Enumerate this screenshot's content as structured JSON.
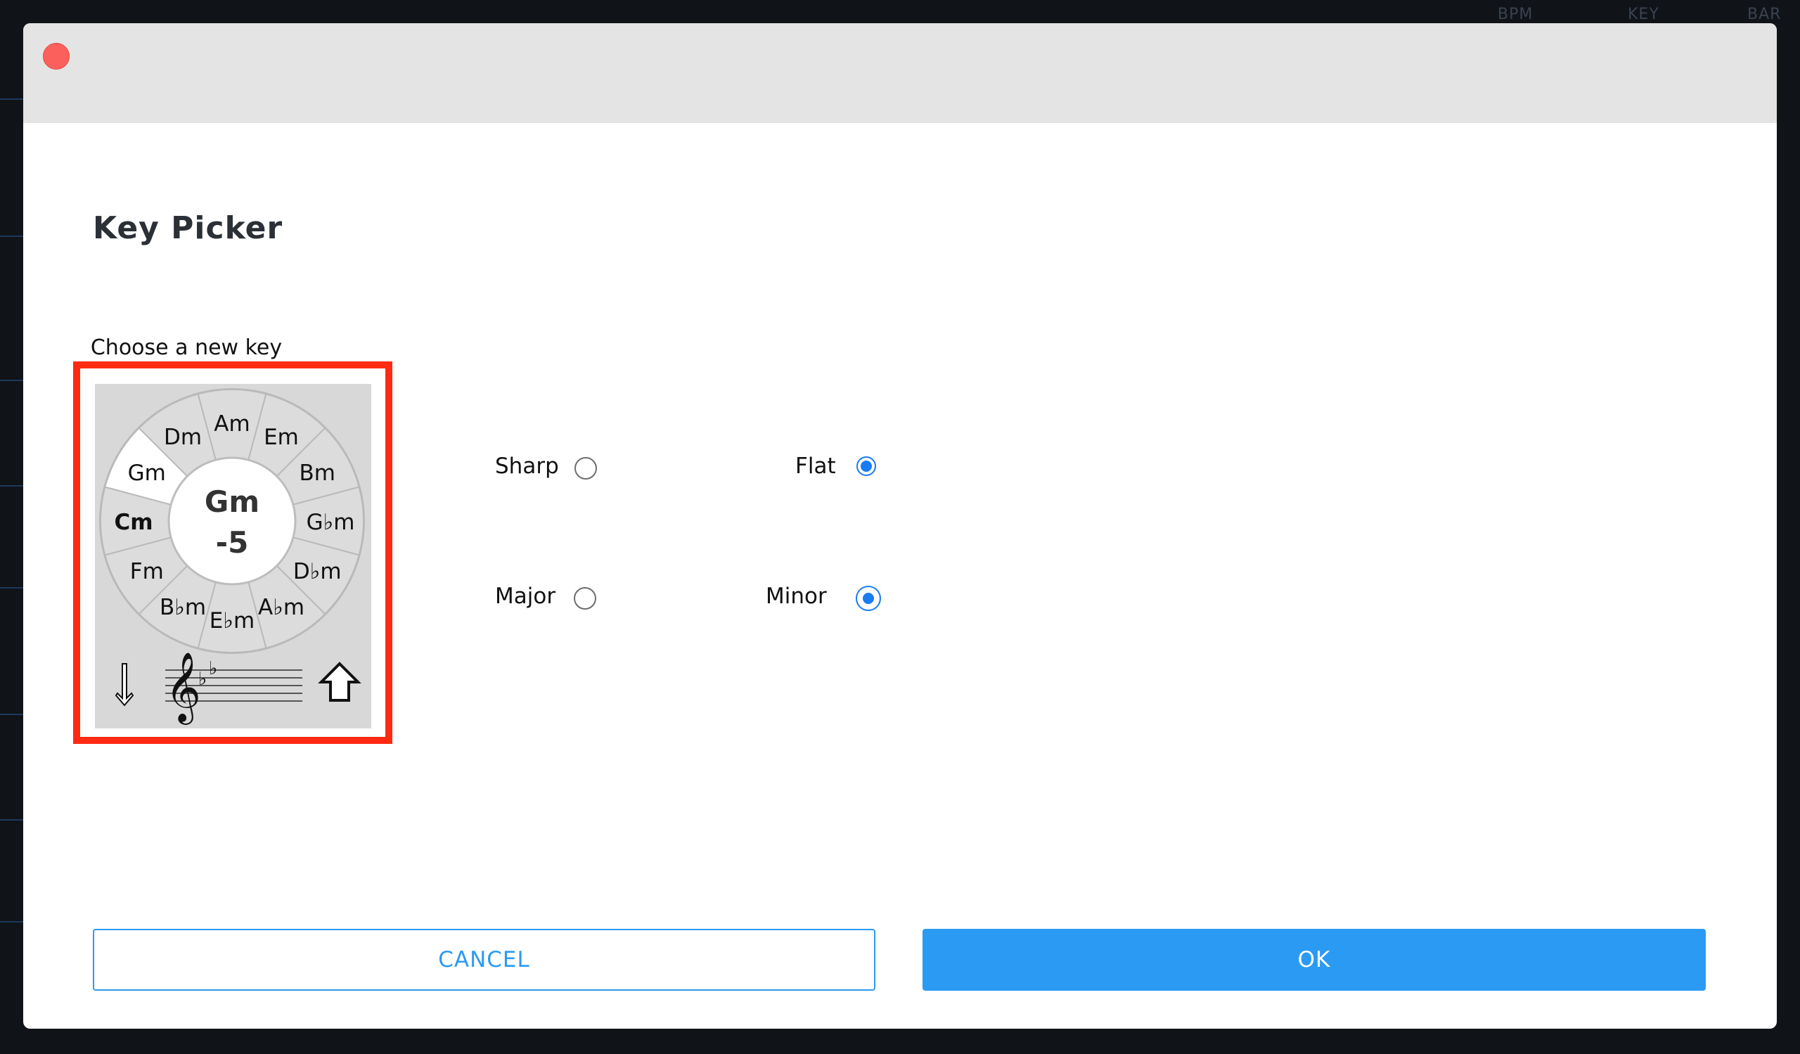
{
  "background": {
    "column_headers": [
      "BPM",
      "KEY",
      "BAR"
    ]
  },
  "dialog": {
    "title": "Key Picker",
    "caption": "Choose a new key",
    "wheel": {
      "keys": [
        "Am",
        "Em",
        "Bm",
        "G♭m",
        "D♭m",
        "A♭m",
        "E♭m",
        "B♭m",
        "Fm",
        "Cm",
        "Gm",
        "Dm"
      ],
      "current_key": "Cm",
      "highlighted_key": "Gm",
      "center_key": "Gm",
      "center_offset": "-5",
      "clef_symbol": "𝄞",
      "flat_symbol": "♭",
      "down_arrow_icon": "arrow-down-icon",
      "up_arrow_icon": "arrow-up-icon"
    },
    "options": {
      "sharp_label": "Sharp",
      "flat_label": "Flat",
      "major_label": "Major",
      "minor_label": "Minor",
      "accidental_selected": "Flat",
      "mode_selected": "Minor"
    },
    "buttons": {
      "cancel_label": "CANCEL",
      "ok_label": "OK"
    }
  },
  "colors": {
    "accent": "#2b9af3",
    "radio_selected": "#1a7bf2",
    "highlight_frame": "#ff2a12",
    "close_button": "#fc605c"
  }
}
